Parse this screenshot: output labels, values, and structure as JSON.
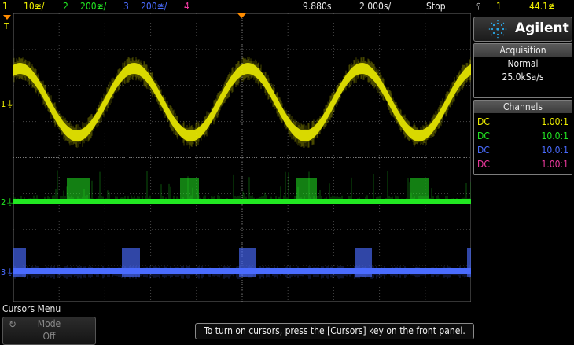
{
  "colors": {
    "ch1": "#f2f200",
    "ch2": "#22e822",
    "ch3": "#4a6cff",
    "ch4": "#f03aa0",
    "trigger": "#ff8c00",
    "grid": "#5a5a5a"
  },
  "topbar": {
    "ch1_num": "1",
    "ch1_scale": "10≇/",
    "ch2_num": "2",
    "ch2_scale": "200≇/",
    "ch3_num": "3",
    "ch3_scale": "200≇/",
    "ch4_num": "4",
    "time_pos": "9.880s",
    "time_scale": "2.000s/",
    "run_state": "Stop",
    "trig_icon": "⫯",
    "trig_ch": "1",
    "trig_level": "44.1≇"
  },
  "markers": {
    "trig_T": "T",
    "ch1": "1",
    "ch2": "2",
    "ch3": "3"
  },
  "logo": {
    "brand": "Agilent",
    "icon": "agilent-spark-icon"
  },
  "acquisition": {
    "header": "Acquisition",
    "mode": "Normal",
    "rate": "25.0kSa/s"
  },
  "channels": {
    "header": "Channels",
    "rows": [
      {
        "coupling": "DC",
        "ratio": "1.00:1",
        "color": "#f2f200"
      },
      {
        "coupling": "DC",
        "ratio": "10.0:1",
        "color": "#22e822"
      },
      {
        "coupling": "DC",
        "ratio": "10.0:1",
        "color": "#4a6cff"
      },
      {
        "coupling": "DC",
        "ratio": "1.00:1",
        "color": "#f03aa0"
      }
    ]
  },
  "menu": {
    "title": "Cursors Menu",
    "softkey_label": "Mode",
    "softkey_value": "Off",
    "softkey_icon": "↻"
  },
  "message": "To turn on cursors, press the [Cursors] key on the front panel."
}
